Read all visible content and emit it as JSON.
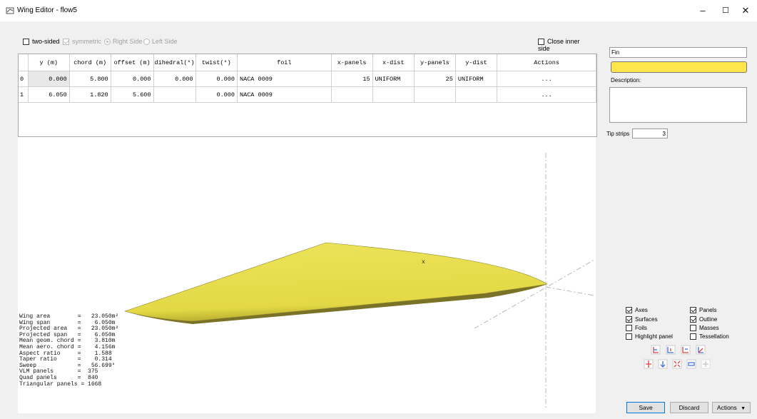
{
  "window": {
    "title": "Wing Editor - flow5"
  },
  "titlebar": {
    "minimize_glyph": "–",
    "maximize_glyph": "☐",
    "close_glyph": "✕"
  },
  "options": {
    "two_sided": {
      "label": "two-sided",
      "checked": false
    },
    "symmetric": {
      "label": "symmetric",
      "checked": true,
      "enabled": false
    },
    "right_side": {
      "label": "Right Side",
      "selected": true,
      "enabled": false
    },
    "left_side": {
      "label": "Left Side",
      "selected": false,
      "enabled": false
    },
    "close_inner_side": {
      "label": "Close inner side",
      "checked": false
    }
  },
  "table": {
    "columns": [
      "y (m)",
      "chord (m)",
      "offset (m)",
      "dihedral(°)",
      "twist(°)",
      "foil",
      "x-panels",
      "x-dist",
      "y-panels",
      "y-dist",
      "Actions"
    ],
    "rows": [
      {
        "index": "0",
        "y": "0.000",
        "chord": "5.800",
        "offset": "0.000",
        "dihedral": "0.000",
        "twist": "0.000",
        "foil": "NACA 0009",
        "x_panels": "15",
        "x_dist": "UNIFORM",
        "y_panels": "25",
        "y_dist": "UNIFORM",
        "actions": "..."
      },
      {
        "index": "1",
        "y": "6.050",
        "chord": "1.820",
        "offset": "5.600",
        "dihedral": "",
        "twist": "0.000",
        "foil": "NACA 0009",
        "x_panels": "",
        "x_dist": "",
        "y_panels": "",
        "y_dist": "",
        "actions": "..."
      }
    ]
  },
  "view": {
    "cg_marker": "x"
  },
  "stats": {
    "lines": [
      "Wing area        =   23.050m²",
      "Wing span        =    6.050m",
      "Projected area   =   23.050m²",
      "Projected span   =    6.050m",
      "Mean geom. chord =    3.810m",
      "Mean aero. chord =    4.156m",
      "Aspect ratio     =    1.588",
      "Taper ratio      =    0.314",
      "Sweep            =   56.699°",
      "VLM panels       =  375",
      "Quad panels      =  840",
      "Triangular panels = 1668"
    ]
  },
  "properties": {
    "name_value": "Fin",
    "color": "#fde64b",
    "description_label": "Description:",
    "description_value": "",
    "tip_strips_label": "Tip strips",
    "tip_strips_value": "3"
  },
  "display": {
    "axes": {
      "label": "Axes",
      "checked": true
    },
    "panels": {
      "label": "Panels",
      "checked": true
    },
    "surfaces": {
      "label": "Surfaces",
      "checked": true
    },
    "outline": {
      "label": "Outline",
      "checked": true
    },
    "foils": {
      "label": "Foils",
      "checked": false
    },
    "masses": {
      "label": "Masses",
      "checked": false
    },
    "highlight_panel": {
      "label": "Highlight panel",
      "checked": false
    },
    "tessellation": {
      "label": "Tessellation",
      "checked": false
    }
  },
  "buttons": {
    "save": "Save",
    "discard": "Discard",
    "actions": "Actions",
    "actions_arrow": "▼"
  },
  "colors": {
    "wing_fill": "#e8dc4a",
    "wing_edge": "#6a6420",
    "accent": "#0078d7"
  }
}
